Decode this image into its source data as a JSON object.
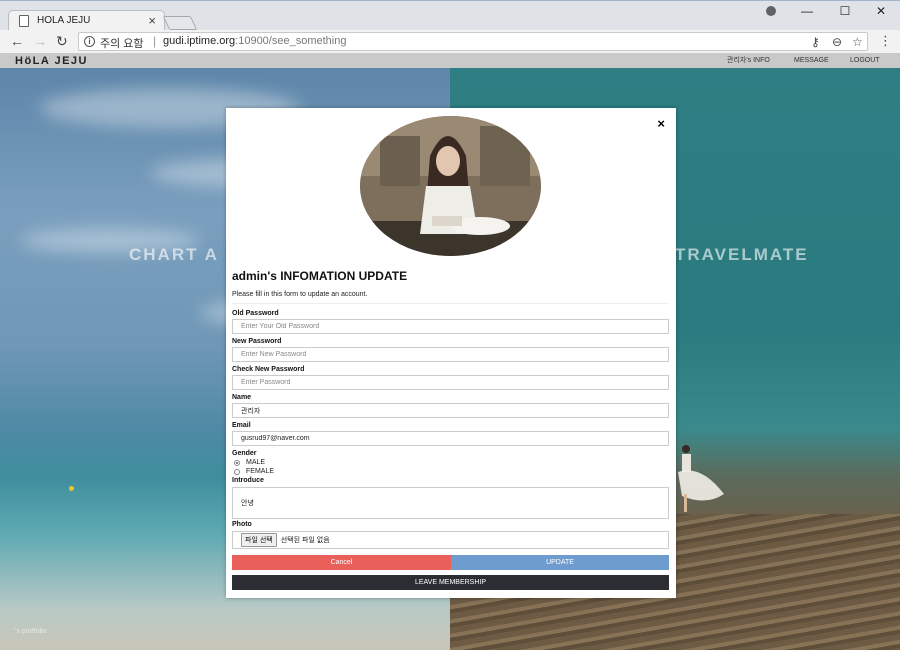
{
  "browser": {
    "tab_title": "HOLA JEJU",
    "tab_close": "×",
    "window_controls": {
      "minimize": "—",
      "maximize": "☐",
      "close": "✕"
    },
    "security_text": "주의 요함",
    "url_host": "gudi.iptime.org",
    "url_rest": ":10900/see_something",
    "icons": [
      "back-icon",
      "forward-icon",
      "reload-icon",
      "info-icon",
      "key-icon",
      "zoom-icon",
      "star-icon",
      "menu-icon",
      "profile-icon"
    ]
  },
  "site": {
    "logo": "HöLA JEJU",
    "nav": [
      "관리자's INFO",
      "MESSAGE",
      "LOGOUT"
    ],
    "bg_left_title": "CHART A",
    "bg_right_title": "TRAVELMATE",
    "portfolio_label": "'s portfolio"
  },
  "modal": {
    "close": "×",
    "title": "admin's INFOMATION UPDATE",
    "subtitle": "Please fill in this form to update an account.",
    "fields": {
      "old_password": {
        "label": "Old Password",
        "placeholder": "Enter Your Old Password",
        "value": ""
      },
      "new_password": {
        "label": "New Password",
        "placeholder": "Enter New Password",
        "value": ""
      },
      "check_password": {
        "label": "Check New Password",
        "placeholder": "Enter Password",
        "value": ""
      },
      "name": {
        "label": "Name",
        "value": "관리자"
      },
      "email": {
        "label": "Email",
        "value": "gusrud97@naver.com"
      },
      "gender": {
        "label": "Gender",
        "options": [
          "MALE",
          "FEMALE"
        ],
        "selected": "MALE"
      },
      "introduce": {
        "label": "Introduce",
        "value": "안녕"
      },
      "photo": {
        "label": "Photo",
        "button": "파일 선택",
        "status": "선택된 파일 없음"
      }
    },
    "buttons": {
      "cancel": "Cancel",
      "update": "UPDATE",
      "leave": "LEAVE MEMBERSHIP"
    }
  }
}
